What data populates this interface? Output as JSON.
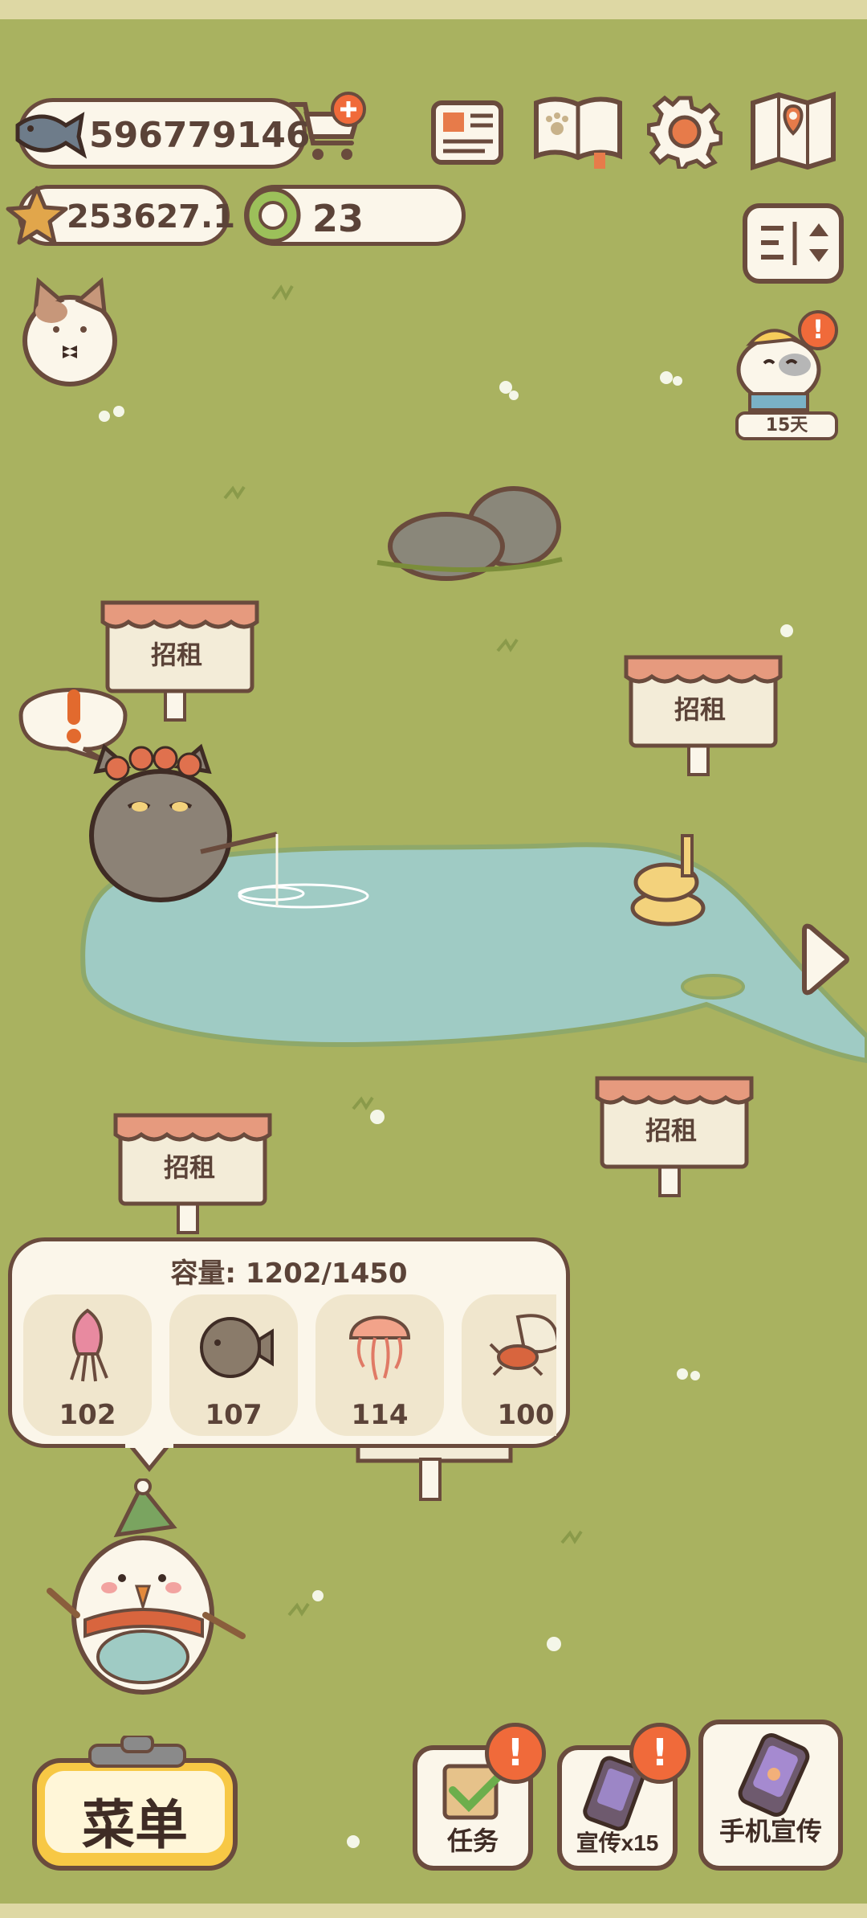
{
  "currencies": {
    "fish": "596779146",
    "star": "253627.1",
    "token": "23"
  },
  "rent_sign": "招租",
  "event_timer": "15天",
  "alert": "!",
  "inventory": {
    "capacity_label": "容量: 1202/1450",
    "items": [
      {
        "name": "squid",
        "count": "102"
      },
      {
        "name": "pufferfish",
        "count": "107"
      },
      {
        "name": "jellyfish",
        "count": "114"
      },
      {
        "name": "hermit-crab",
        "count": "100"
      }
    ]
  },
  "bottom_bar": {
    "menu": "菜单",
    "tasks": "任务",
    "promote": "宣传x15",
    "phone_promote": "手机宣传"
  },
  "colors": {
    "grass": "#a9b260",
    "pond": "#9fcbc4",
    "outline": "#6a4b3d",
    "accent_orange": "#f06a3a",
    "menu_yellow": "#f7c845"
  }
}
